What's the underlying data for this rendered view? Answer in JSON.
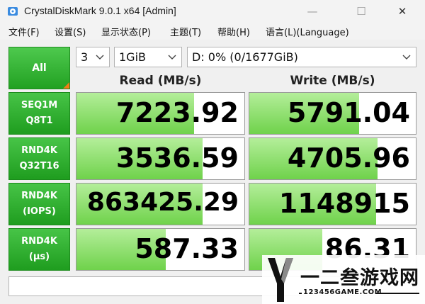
{
  "window": {
    "title": "CrystalDiskMark 9.0.1 x64 [Admin]",
    "minimize_glyph": "—",
    "maximize_glyph": "☐",
    "close_glyph": "✕"
  },
  "menu": {
    "file": "文件(F)",
    "settings": "设置(S)",
    "view": "显示状态(P)",
    "theme": "主题(T)",
    "help": "帮助(H)",
    "language": "语言(L)(Language)"
  },
  "controls": {
    "all_label": "All",
    "count_value": "3",
    "size_value": "1GiB",
    "drive_value": "D: 0% (0/1677GiB)"
  },
  "headers": {
    "read": "Read (MB/s)",
    "write": "Write (MB/s)"
  },
  "rows": [
    {
      "line1": "SEQ1M",
      "line2": "Q8T1",
      "read": "7223.92",
      "write": "5791.04",
      "read_fill": 0.7,
      "write_fill": 0.66
    },
    {
      "line1": "RND4K",
      "line2": "Q32T16",
      "read": "3536.59",
      "write": "4705.96",
      "read_fill": 0.75,
      "write_fill": 0.77
    },
    {
      "line1": "RND4K",
      "line2": "(IOPS)",
      "read": "863425.29",
      "write": "1148915",
      "read_fill": 0.75,
      "write_fill": 0.76
    },
    {
      "line1": "RND4K",
      "line2": "(μs)",
      "read": "587.33",
      "write": "86.31",
      "read_fill": 0.53,
      "write_fill": 0.44
    }
  ],
  "status": {
    "text": ""
  },
  "watermark": {
    "logo_letter": "Y",
    "chinese": "一二叁游戏网",
    "url": "123456GAME.COM",
    "colors": {
      "primary": "#111111",
      "accent": "#8a8a8a"
    }
  },
  "colors": {
    "label_green": "#22a122",
    "bar_light": "#b4ee9a",
    "bar_dark": "#6fd24b",
    "corner_orange": "#f07c16"
  }
}
